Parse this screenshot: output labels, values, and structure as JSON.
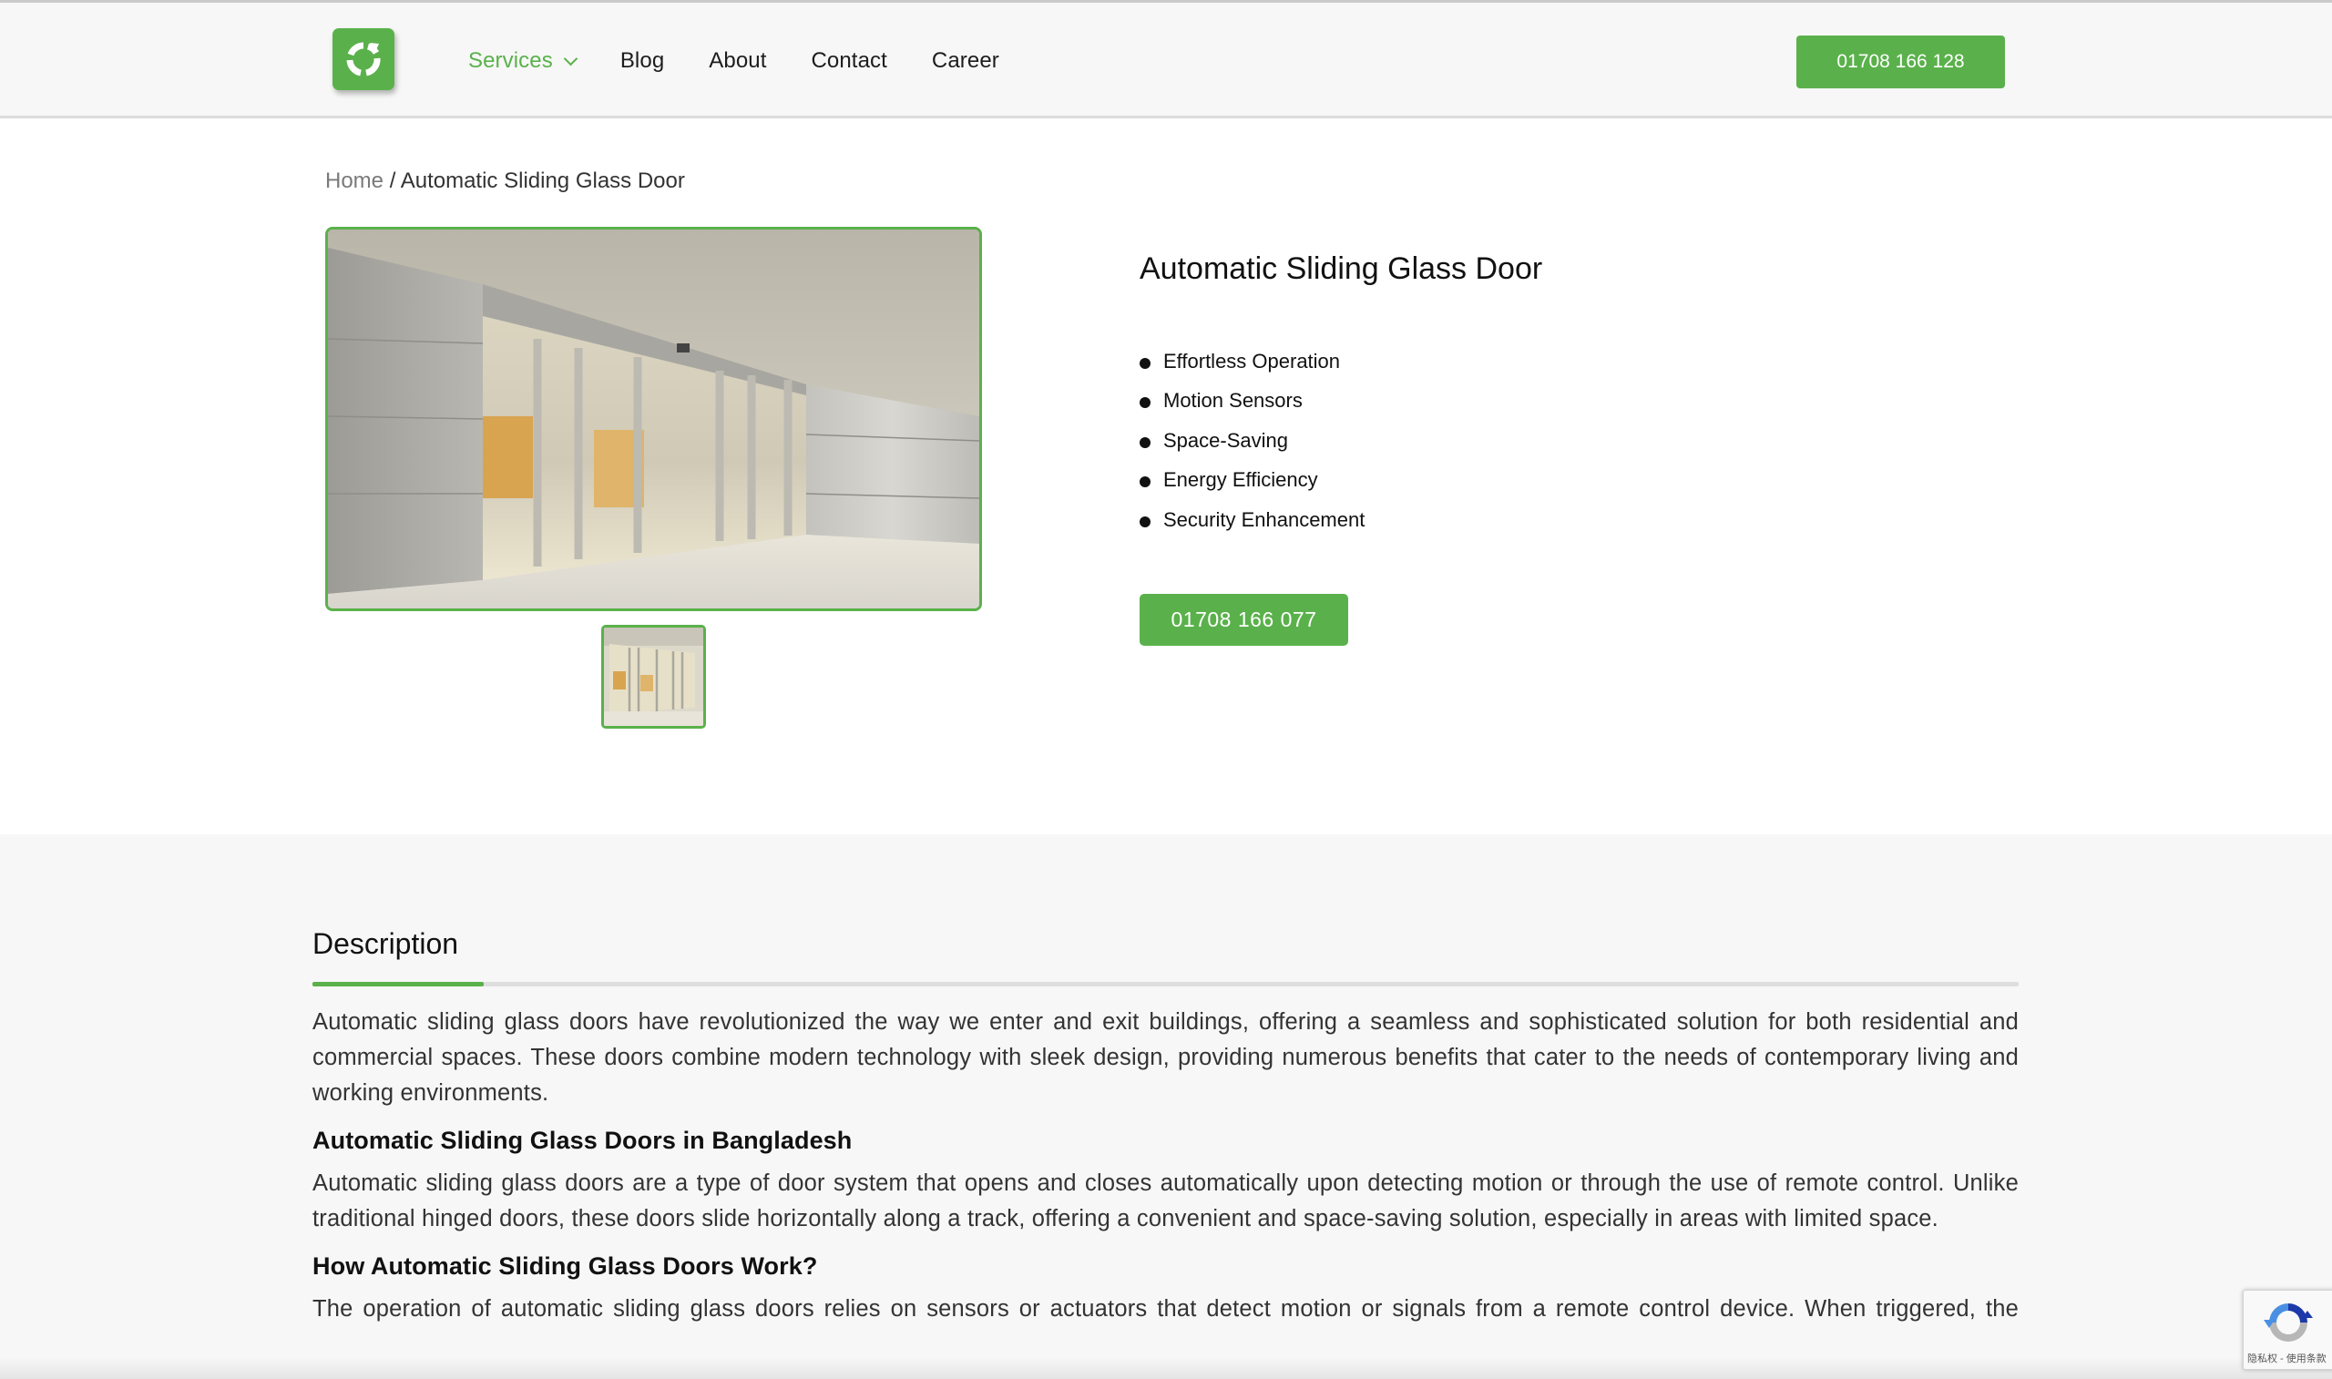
{
  "header": {
    "logo_icon": "refresh-ring-logo",
    "nav": [
      {
        "label": "Services",
        "active": true,
        "has_dropdown": true
      },
      {
        "label": "Blog",
        "active": false
      },
      {
        "label": "About",
        "active": false
      },
      {
        "label": "Contact",
        "active": false
      },
      {
        "label": "Career",
        "active": false
      }
    ],
    "phone_button": "01708 166 128"
  },
  "breadcrumb": {
    "home": "Home",
    "separator": " / ",
    "current": "Automatic Sliding Glass Door"
  },
  "product": {
    "title": "Automatic Sliding Glass Door",
    "features": [
      "Effortless Operation",
      "Motion Sensors",
      "Space-Saving",
      "Energy Efficiency",
      "Security Enhancement"
    ],
    "call_button": "01708 166 077",
    "main_image_alt": "Automatic sliding glass door entrance",
    "thumbnail_count": 1
  },
  "description": {
    "tab_label": "Description",
    "intro": "Automatic sliding glass doors have revolutionized the way we enter and exit buildings, offering a seamless and sophisticated solution for both residential and commercial spaces. These doors combine modern technology with sleek design, providing numerous benefits that cater to the needs of contemporary living and working environments.",
    "section1_heading": "Automatic Sliding Glass Doors in Bangladesh",
    "section1_text": "Automatic sliding glass doors are a type of door system that opens and closes automatically upon detecting motion or through the use of remote control. Unlike traditional hinged doors, these doors slide horizontally along a track, offering a convenient and space-saving solution, especially in areas with limited space.",
    "section2_heading": "How Automatic Sliding Glass Doors Work?",
    "section2_text": "The operation of automatic sliding glass doors relies on sensors or actuators that detect motion or signals from a remote control device. When triggered, the"
  },
  "recaptcha": {
    "icon": "recaptcha-icon",
    "text": "隐私权 - 使用条款"
  },
  "colors": {
    "brand_green": "#5ab14b",
    "header_bg": "#f6f7f6",
    "section_bg": "#f7f7f7"
  }
}
